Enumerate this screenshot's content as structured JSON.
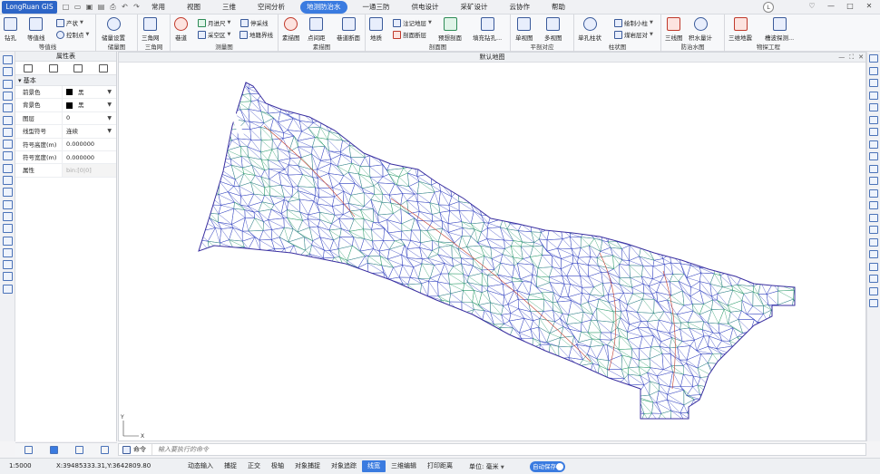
{
  "app": {
    "brand": "LongRuan GIS",
    "quick_icons": [
      "new-file-icon",
      "open-file-icon",
      "save-icon",
      "save-as-icon",
      "print-icon",
      "undo-icon",
      "redo-icon"
    ],
    "user_avatar": "L"
  },
  "menus": [
    "常用",
    "视图",
    "三维",
    "空间分析",
    "地测防治水",
    "一通三防",
    "供电设计",
    "采矿设计",
    "云协作",
    "帮助"
  ],
  "active_menu": "地测防治水",
  "ribbon": {
    "groups": [
      {
        "title": "等值线",
        "items": [
          "钻孔",
          "等值线",
          "产状",
          "控制点"
        ]
      },
      {
        "title": "储量图",
        "items": [
          "储量设置"
        ]
      },
      {
        "title": "三角网",
        "items": [
          "三角网"
        ]
      },
      {
        "title": "测量图",
        "items": [
          "巷道",
          "月进尺",
          "停采线",
          "采空区",
          "地籍界线"
        ]
      },
      {
        "title": "素描图",
        "items": [
          "素描图",
          "点间距",
          "巷道断面"
        ]
      },
      {
        "title": "剖面图",
        "items": [
          "地质",
          "注记地层",
          "剖面断层",
          "预想剖面",
          "填充钻孔..."
        ]
      },
      {
        "title": "平剖对应",
        "items": [
          "单视图",
          "多视图"
        ]
      },
      {
        "title": "柱状图",
        "items": [
          "单孔柱状",
          "绘制小柱",
          "煤岩层对"
        ]
      },
      {
        "title": "防治水图",
        "items": [
          "三线图",
          "积水量计"
        ]
      },
      {
        "title": "物探工程",
        "items": [
          "三维地震",
          "槽波探测..."
        ]
      }
    ]
  },
  "properties": {
    "title": "属性表",
    "section": "基本",
    "rows": [
      {
        "key": "前景色",
        "value": "黑"
      },
      {
        "key": "背景色",
        "value": "黑"
      },
      {
        "key": "图层",
        "value": "0"
      },
      {
        "key": "线型符号",
        "value": "连续"
      },
      {
        "key": "符号高度(m)",
        "value": "0.000000"
      },
      {
        "key": "符号宽度(m)",
        "value": "0.000000"
      },
      {
        "key": "属性",
        "value": "bin:[0|0]"
      }
    ]
  },
  "map": {
    "title": "默认地图",
    "axis_x": "X",
    "axis_y": "Y"
  },
  "command": {
    "label": "命令",
    "placeholder": "输入要执行的命令"
  },
  "status": {
    "scale": "1:5000",
    "coords": "X:39485333.31,Y:3642809.80",
    "buttons": [
      "动态输入",
      "捕捉",
      "正交",
      "极轴",
      "对象捕捉",
      "对象追踪",
      "线宽",
      "三维编辑",
      "打印距离"
    ],
    "active_button": "线宽",
    "unit_label": "单位:",
    "unit_value": "毫米",
    "autosave": "自动保存"
  },
  "colors": {
    "accent": "#3a7be0",
    "mesh_blue": "#2f3fbf",
    "mesh_green": "#2a9a6a",
    "mesh_red": "#c0392b"
  }
}
